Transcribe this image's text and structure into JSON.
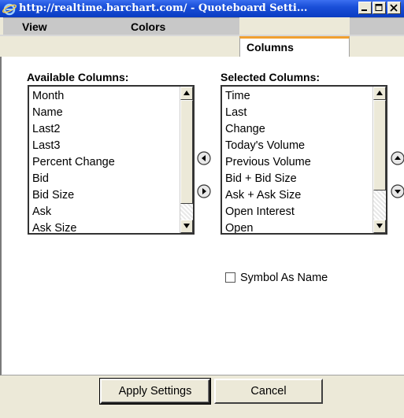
{
  "window": {
    "title": "http://realtime.barchart.com/ - Quoteboard Setti..."
  },
  "tabs": [
    {
      "label": "View"
    },
    {
      "label": "Colors"
    },
    {
      "label": "Columns",
      "active": true
    }
  ],
  "available": {
    "label": "Available Columns:",
    "items": [
      "Month",
      "Name",
      "Last2",
      "Last3",
      "Percent Change",
      "Bid",
      "Bid Size",
      "Ask",
      "Ask Size"
    ]
  },
  "selected": {
    "label": "Selected Columns:",
    "items": [
      "Time",
      "Last",
      "Change",
      "Today's Volume",
      "Previous Volume",
      "Bid + Bid Size",
      "Ask + Ask Size",
      "Open Interest",
      "Open"
    ]
  },
  "options": {
    "symbol_as_name": {
      "label": "Symbol As Name",
      "checked": false
    }
  },
  "buttons": {
    "apply": "Apply Settings",
    "cancel": "Cancel"
  },
  "colors": {
    "titlebar": "#0a3cc2",
    "active_tab_accent": "#f0a030",
    "dialog_bg": "#ece9d8"
  }
}
